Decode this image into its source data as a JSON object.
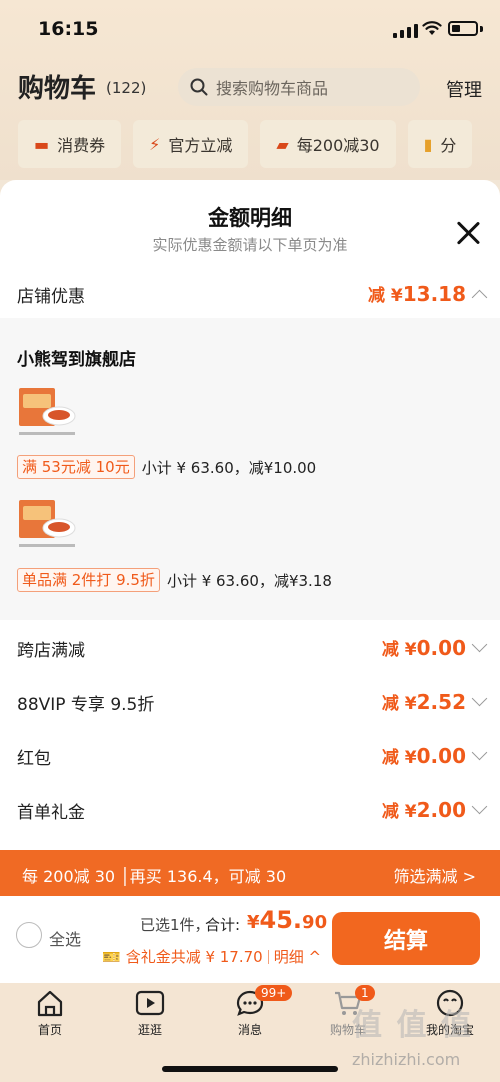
{
  "status": {
    "time": "16:15"
  },
  "cart": {
    "title": "购物车",
    "count": "(122)",
    "search_placeholder": "搜索购物车商品",
    "manage": "管理",
    "chips": [
      {
        "label": "消费券",
        "icon": "coupon-icon"
      },
      {
        "label": "官方立减",
        "icon": "lightning-icon"
      },
      {
        "label": "每200减30",
        "icon": "shop-icon"
      },
      {
        "label": "分",
        "icon": "folder-icon"
      }
    ]
  },
  "sheet": {
    "title": "金额明细",
    "subtitle": "实际优惠金额请以下单页为准",
    "store_discount": {
      "label": "店铺优惠",
      "prefix": "减 ¥",
      "amount": "13.18"
    },
    "shop": {
      "name": "小熊驾到旗舰店",
      "items": [
        {
          "tag": "满 53元减 10元",
          "subtotal": "小计 ¥ 63.60，减¥10.00"
        },
        {
          "tag": "单品满 2件打 9.5折",
          "subtotal": "小计 ¥ 63.60，减¥3.18"
        }
      ]
    },
    "rows": [
      {
        "label": "跨店满减",
        "prefix": "减 ¥",
        "amount": "0.00"
      },
      {
        "label": "88VIP 专享 9.5折",
        "prefix": "减 ¥",
        "amount": "2.52"
      },
      {
        "label": "红包",
        "prefix": "减 ¥",
        "amount": "0.00"
      },
      {
        "label": "首单礼金",
        "prefix": "减 ¥",
        "amount": "2.00"
      }
    ],
    "banner": {
      "left": "每 200减 30 │再买 136.4，可减 30",
      "right": "筛选满减 >"
    }
  },
  "checkout": {
    "select_all": "全选",
    "selected": "已选1件，",
    "total_label": "合计:",
    "currency": "¥",
    "total_int": "45.",
    "total_dec": "90",
    "gift": "含礼金共减 ¥ 17.70",
    "detail": "明细 ^",
    "button": "结算"
  },
  "tabs": [
    {
      "label": "首页",
      "icon": "home-icon"
    },
    {
      "label": "逛逛",
      "icon": "play-icon"
    },
    {
      "label": "消息",
      "icon": "message-icon",
      "badge": "99+"
    },
    {
      "label": "购物车",
      "icon": "cart-icon",
      "badge": "1"
    },
    {
      "label": "我的淘宝",
      "icon": "profile-icon"
    }
  ],
  "watermark": {
    "text": "值 值 值",
    "url": "zhizhizhi.com"
  },
  "colors": {
    "accent": "#f05a1a",
    "banner": "#f06a24",
    "button": "#f2671f"
  }
}
